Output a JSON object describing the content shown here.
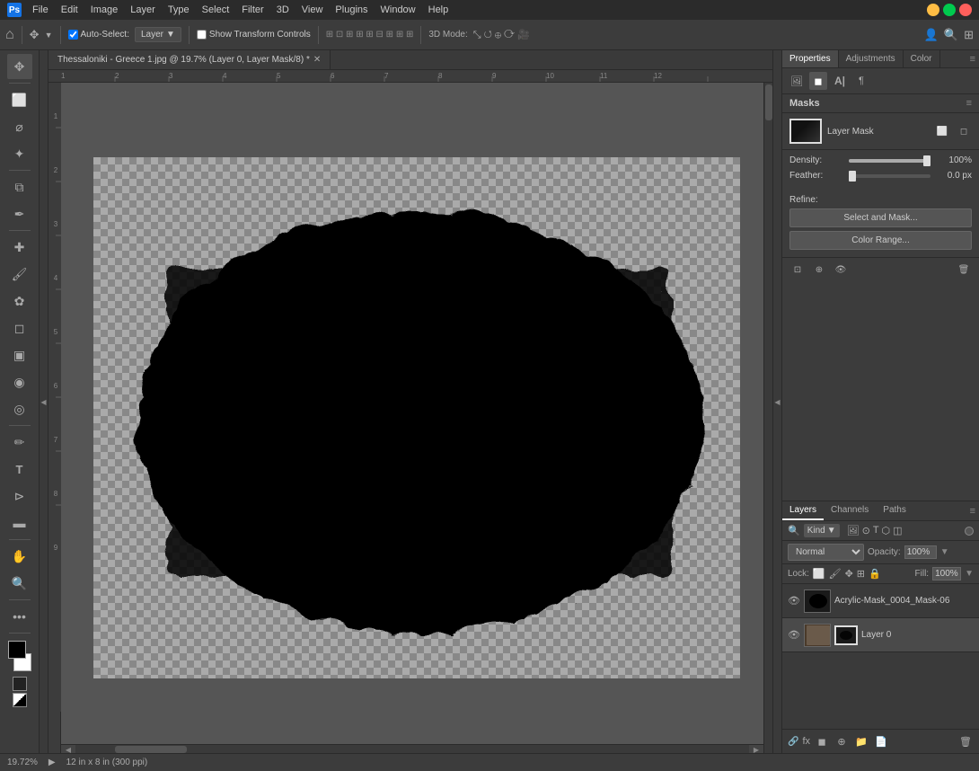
{
  "titlebar": {
    "app_name": "Ps",
    "menus": [
      "File",
      "Edit",
      "Image",
      "Layer",
      "Type",
      "Select",
      "Filter",
      "3D",
      "View",
      "Plugins",
      "Window",
      "Help"
    ]
  },
  "optionsbar": {
    "move_icon": "✥",
    "auto_select_label": "Auto-Select:",
    "layer_dropdown": "Layer",
    "show_transform_label": "Show Transform Controls",
    "mode_label": "3D Mode:"
  },
  "document": {
    "tab_title": "Thessaloniki - Greece 1.jpg @ 19.7% (Layer 0, Layer Mask/8) *",
    "zoom": "19.72%",
    "dimensions": "12 in x 8 in (300 ppi)"
  },
  "properties": {
    "tabs": [
      "Properties",
      "Adjustments",
      "Color"
    ],
    "active_tab": "Properties",
    "masks_title": "Masks",
    "layer_mask_label": "Layer Mask",
    "density_label": "Density:",
    "density_value": "100%",
    "feather_label": "Feather:",
    "feather_value": "0.0 px",
    "refine_label": "Refine:",
    "select_mask_btn": "Select and Mask...",
    "color_range_btn": "Color Range..."
  },
  "layers": {
    "tabs": [
      "Layers",
      "Channels",
      "Paths"
    ],
    "active_tab": "Layers",
    "filter_label": "Kind",
    "blend_mode": "Normal",
    "opacity_label": "Opacity:",
    "opacity_value": "100%",
    "lock_label": "Lock:",
    "fill_label": "Fill:",
    "fill_value": "100%",
    "items": [
      {
        "name": "Acrylic-Mask_0004_Mask-06",
        "visible": true,
        "has_mask": false
      },
      {
        "name": "Layer 0",
        "visible": true,
        "has_mask": true
      }
    ],
    "bottom_actions": [
      "fx",
      "circle-half",
      "adjustment",
      "folder",
      "new",
      "trash"
    ]
  },
  "toolbar": {
    "tools": [
      "move",
      "select-rect",
      "lasso",
      "magic-wand",
      "crop",
      "eyedropper",
      "heal",
      "brush",
      "clone",
      "eraser",
      "gradient",
      "blur",
      "dodge",
      "pen",
      "text",
      "path-select",
      "shape",
      "hand",
      "zoom"
    ],
    "fg_color": "#000000",
    "bg_color": "#ffffff"
  }
}
